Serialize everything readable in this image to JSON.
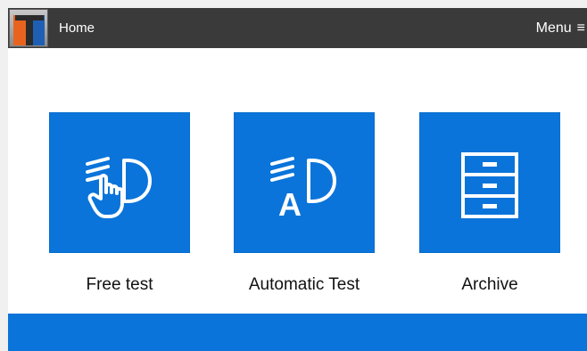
{
  "header": {
    "logo_letter": "T",
    "home_label": "Home",
    "menu_label": "Menu",
    "menu_icon": "hamburger-icon"
  },
  "tiles": [
    {
      "label": "Free test",
      "icon": "headlight-hand-icon"
    },
    {
      "label": "Automatic Test",
      "icon": "headlight-auto-icon",
      "icon_text": "A"
    },
    {
      "label": "Archive",
      "icon": "archive-cabinet-icon"
    }
  ],
  "colors": {
    "topbar": "#3a3a3a",
    "accent_blue": "#0a74da",
    "logo_orange": "#e8641e",
    "logo_blue": "#1e5fb4"
  }
}
